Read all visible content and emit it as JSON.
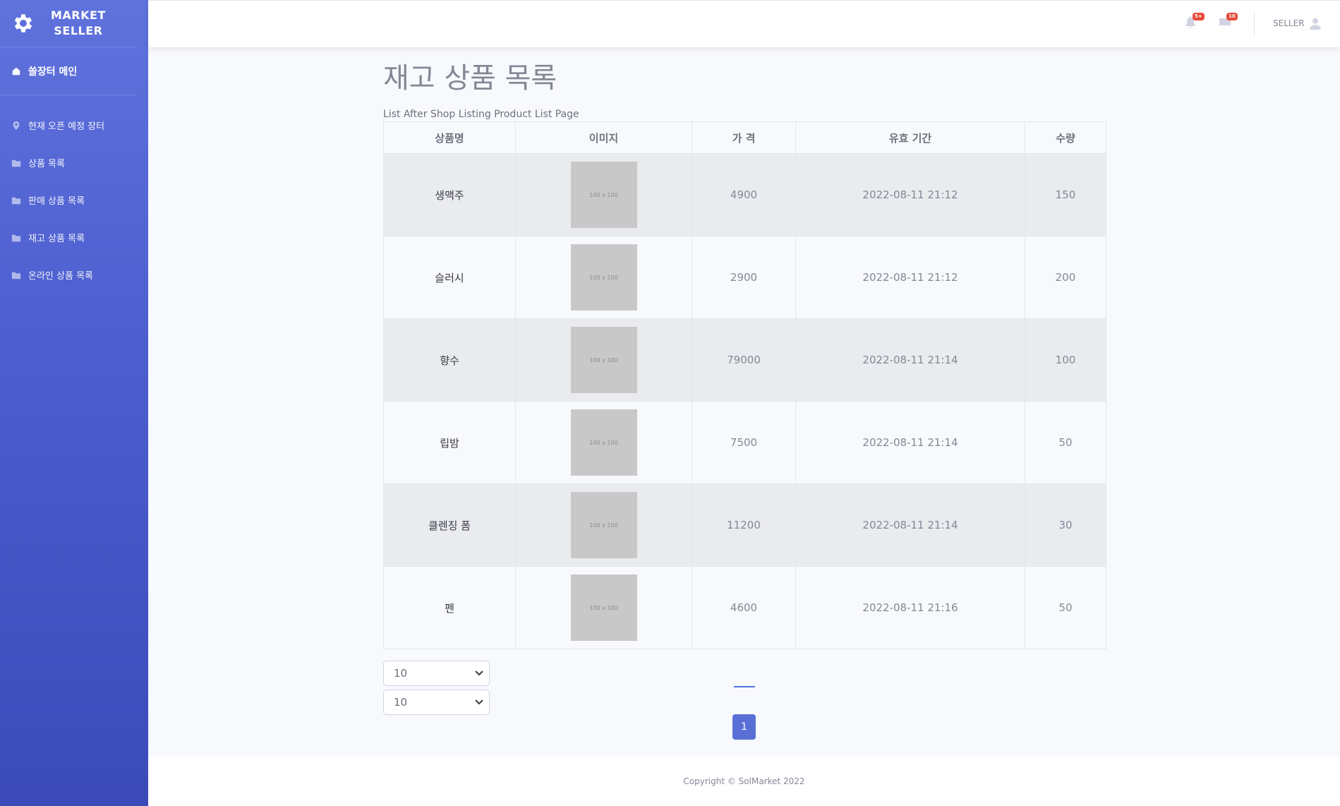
{
  "brand": {
    "line1": "MARKET",
    "line2": "SELLER",
    "icon": "gear-icon"
  },
  "sidebar": {
    "main_item": {
      "label": "쏠장터 메인",
      "icon": "store-icon"
    },
    "items": [
      {
        "label": "현재 오픈 예정 장터",
        "icon": "map-marker-icon"
      },
      {
        "label": "상품 목록",
        "icon": "folder-icon"
      },
      {
        "label": "판매 상품 목록",
        "icon": "folder-icon"
      },
      {
        "label": "재고 상품 목록",
        "icon": "folder-icon"
      },
      {
        "label": "온라인 상품 목록",
        "icon": "folder-icon"
      }
    ]
  },
  "topbar": {
    "alerts_badge": "5+",
    "messages_badge": "10",
    "user_label": "SELLER"
  },
  "page": {
    "title": "재고 상품 목록",
    "subtitle": "List After Shop Listing Product List Page"
  },
  "table": {
    "headers": [
      "상품명",
      "이미지",
      "가 격",
      "유효 기간",
      "수량"
    ],
    "placeholder_text": "100 x 100",
    "rows": [
      {
        "name": "생맥주",
        "price": "4900",
        "expiry": "2022-08-11 21:12",
        "qty": "150"
      },
      {
        "name": "슬러시",
        "price": "2900",
        "expiry": "2022-08-11 21:12",
        "qty": "200"
      },
      {
        "name": "향수",
        "price": "79000",
        "expiry": "2022-08-11 21:14",
        "qty": "100"
      },
      {
        "name": "립밤",
        "price": "7500",
        "expiry": "2022-08-11 21:14",
        "qty": "50"
      },
      {
        "name": "클렌징 폼",
        "price": "11200",
        "expiry": "2022-08-11 21:14",
        "qty": "30"
      },
      {
        "name": "펜",
        "price": "4600",
        "expiry": "2022-08-11 21:16",
        "qty": "50"
      }
    ]
  },
  "controls": {
    "page_size_1": "10",
    "page_size_2": "10",
    "current_page": "1"
  },
  "footer": {
    "copyright": "Copyright © SolMarket 2022"
  },
  "colors": {
    "sidebar_top": "#5f72dc",
    "sidebar_bottom": "#3b4ab9",
    "accent": "#5a6fd6",
    "badge": "#e74a3b"
  }
}
